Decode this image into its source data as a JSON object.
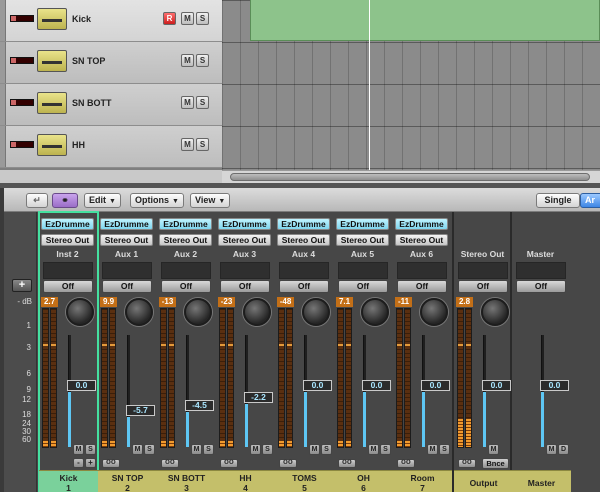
{
  "tracks": [
    {
      "name": "Kick",
      "buttons": [
        "R",
        "M",
        "S"
      ]
    },
    {
      "name": "SN TOP",
      "buttons": [
        "M",
        "S"
      ]
    },
    {
      "name": "SN BOTT",
      "buttons": [
        "M",
        "S"
      ]
    },
    {
      "name": "HH",
      "buttons": [
        "M",
        "S"
      ]
    }
  ],
  "toolbar": {
    "edit": "Edit",
    "options": "Options",
    "view": "View",
    "single": "Single",
    "arrange_tab": "Ar"
  },
  "scale": {
    "db_label": "- dB",
    "marks": [
      "1",
      "3",
      "6",
      "9",
      "12",
      "18",
      "24",
      "30",
      "60"
    ]
  },
  "channels": [
    {
      "insert": "EzDrumme",
      "output": "Stereo Out",
      "route": "Inst 2",
      "off": "Off",
      "peak": "2.7",
      "fader": "0.0",
      "level": 0.7,
      "name": "Kick",
      "number": "1",
      "mute": "M",
      "solo": "S",
      "extra": [
        "-",
        "+"
      ]
    },
    {
      "insert": "EzDrumme",
      "output": "Stereo Out",
      "route": "Aux 1",
      "off": "Off",
      "peak": "9.9",
      "fader": "-5.7",
      "level": 0.44,
      "name": "SN TOP",
      "number": "2",
      "mute": "M",
      "solo": "S"
    },
    {
      "insert": "EzDrumme",
      "output": "Stereo Out",
      "route": "Aux 2",
      "off": "Off",
      "peak": "-13",
      "fader": "-4.5",
      "level": 0.49,
      "name": "SN BOTT",
      "number": "3",
      "mute": "M",
      "solo": "S"
    },
    {
      "insert": "EzDrumme",
      "output": "Stereo Out",
      "route": "Aux 3",
      "off": "Off",
      "peak": "-23",
      "fader": "-2.2",
      "level": 0.58,
      "name": "HH",
      "number": "4",
      "mute": "M",
      "solo": "S"
    },
    {
      "insert": "EzDrumme",
      "output": "Stereo Out",
      "route": "Aux 4",
      "off": "Off",
      "peak": "-48",
      "fader": "0.0",
      "level": 0.7,
      "name": "TOMS",
      "number": "5",
      "mute": "M",
      "solo": "S"
    },
    {
      "insert": "EzDrumme",
      "output": "Stereo Out",
      "route": "Aux 5",
      "off": "Off",
      "peak": "7.1",
      "fader": "0.0",
      "level": 0.7,
      "name": "OH",
      "number": "6",
      "mute": "M",
      "solo": "S"
    },
    {
      "insert": "EzDrumme",
      "output": "Stereo Out",
      "route": "Aux 6",
      "off": "Off",
      "peak": "-11",
      "fader": "0.0",
      "level": 0.7,
      "name": "Room",
      "number": "7",
      "mute": "M",
      "solo": "S"
    }
  ],
  "output_strip": {
    "route": "Stereo Out",
    "off": "Off",
    "peak": "2.8",
    "fader": "0.0",
    "level": 0.7,
    "mute": "M",
    "bounce": "Bnce",
    "name": "Output"
  },
  "master_strip": {
    "route": "Master",
    "off": "Off",
    "fader": "0.0",
    "level": 0.7,
    "mute": "M",
    "dim": "D",
    "name": "Master"
  }
}
